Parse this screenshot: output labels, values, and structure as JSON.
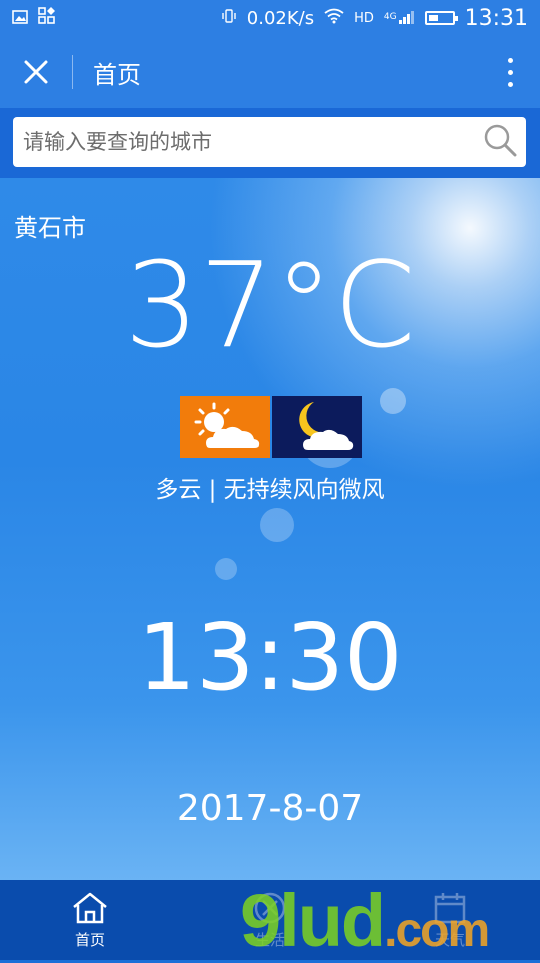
{
  "status_bar": {
    "network_speed": "0.02K/s",
    "hd": "HD",
    "signal_gen": "4G",
    "time": "13:31",
    "battery_level": 0.4
  },
  "app_bar": {
    "title": "首页"
  },
  "search": {
    "placeholder": "请输入要查询的城市",
    "value": ""
  },
  "weather": {
    "city": "黄石市",
    "temperature": "37°C",
    "description": "多云 | 无持续风向微风",
    "day_icon": "partly-cloudy-day-icon",
    "night_icon": "partly-cloudy-night-icon",
    "day_icon_color": "#f27c0b",
    "night_icon_color": "#0c1b5c",
    "time": "13:30",
    "date": "2017-8-07"
  },
  "bottom_nav": {
    "items": [
      {
        "label": "首页",
        "icon": "home-icon"
      },
      {
        "label": "生活",
        "icon": "life-icon"
      },
      {
        "label": "天气",
        "icon": "calendar-icon"
      }
    ]
  },
  "watermark": {
    "text": "9lud",
    "suffix": ".com"
  },
  "colors": {
    "primary": "#2d7fe3",
    "nav_bg": "#0a4cad"
  }
}
